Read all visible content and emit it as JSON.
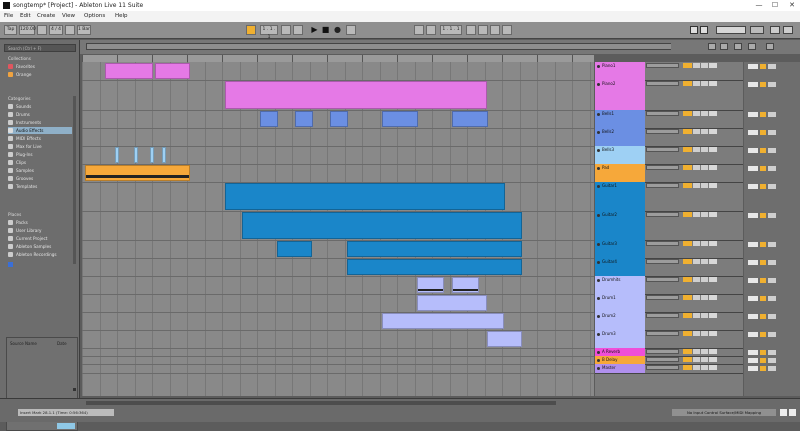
{
  "window": {
    "title": "songtemp* [Project] - Ableton Live 11 Suite",
    "controls": [
      "—",
      "☐",
      "✕"
    ]
  },
  "menu": [
    "File",
    "Edit",
    "Create",
    "View",
    "Options",
    "Help"
  ],
  "controlbar": {
    "left_buttons": [
      "Tap",
      "120.00",
      "",
      "4 / 4",
      "",
      "1 Bar"
    ],
    "center_buttons": [
      "",
      "1 . 1 . 1",
      "",
      "",
      ""
    ],
    "transport": [
      "▶",
      "■",
      "●"
    ],
    "right_buttons": [
      "",
      "",
      "1 . 1 . 1",
      "",
      "",
      "",
      ""
    ]
  },
  "browser": {
    "search_placeholder": "Search (Ctrl + F)",
    "collections_header": "Collections",
    "collections": [
      {
        "label": "Favorites",
        "color": "#e0565f"
      },
      {
        "label": "Orange",
        "color": "#f0a340"
      }
    ],
    "categories_header": "Categories",
    "categories": [
      "Sounds",
      "Drums",
      "Instruments",
      "Audio Effects",
      "MIDI Effects",
      "Max for Live",
      "Plug-Ins",
      "Clips",
      "Samples",
      "Grooves",
      "Templates"
    ],
    "selected_category": "Audio Effects",
    "places_header": "Places",
    "places": [
      "Packs",
      "User Library",
      "Current Project",
      "Ableton Samples",
      "Ableton Recordings"
    ],
    "info_header": "Source Name",
    "info_header2": "Date"
  },
  "tracks": [
    {
      "name": "Piano1",
      "color": "#e579e6"
    },
    {
      "name": "Piano2",
      "color": "#e579e6"
    },
    {
      "name": "Bells1",
      "color": "#6b8fe3"
    },
    {
      "name": "Bells2",
      "color": "#6b8fe3"
    },
    {
      "name": "Bells3",
      "color": "#9ed0f4"
    },
    {
      "name": "Pad",
      "color": "#f6a83a"
    },
    {
      "name": "Guitar1",
      "color": "#1a86c9"
    },
    {
      "name": "Guitar2",
      "color": "#1a86c9"
    },
    {
      "name": "Guitar3",
      "color": "#1a86c9"
    },
    {
      "name": "Guitar4",
      "color": "#1a86c9"
    },
    {
      "name": "Drumhits",
      "color": "#b6bdfb"
    },
    {
      "name": "Drum1",
      "color": "#b6bdfb"
    },
    {
      "name": "Drum2",
      "color": "#b6bdfb"
    },
    {
      "name": "Drum3",
      "color": "#b6bdfb"
    },
    {
      "name": "A Reverb",
      "color": "#ef4fd9"
    },
    {
      "name": "B Delay",
      "color": "#f6a83a"
    },
    {
      "name": "Master",
      "color": "#b090ee"
    }
  ],
  "statusbar": {
    "selection_text": "Insert Mark 28.1.1 (Time: 0:56:364)",
    "midi_text": "No Input Control Surface/MIDI Mapping"
  }
}
